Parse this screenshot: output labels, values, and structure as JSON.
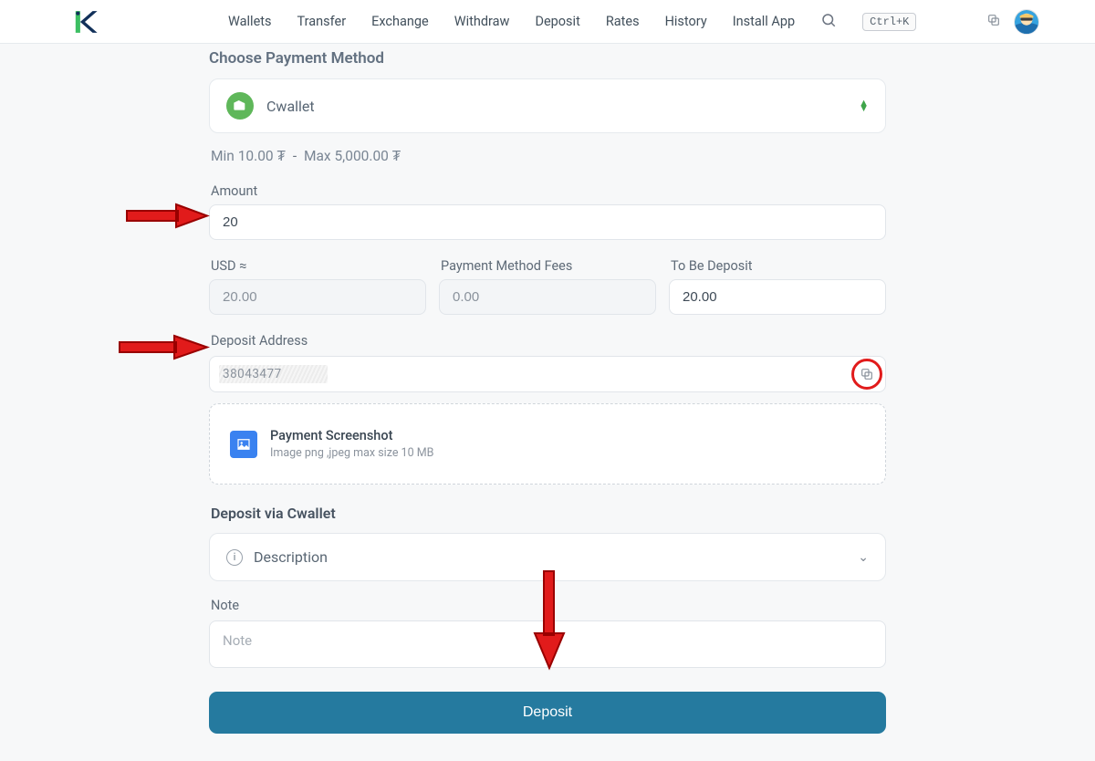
{
  "nav": {
    "items": [
      "Wallets",
      "Transfer",
      "Exchange",
      "Withdraw",
      "Deposit",
      "Rates",
      "History",
      "Install App"
    ],
    "shortcut": "Ctrl+K"
  },
  "section_title": "Choose Payment Method",
  "payment_method": {
    "name": "Cwallet"
  },
  "limits": {
    "min": "Min 10.00 ₮",
    "max": "Max 5,000.00 ₮",
    "separator": "-"
  },
  "amount": {
    "label": "Amount",
    "value": "20"
  },
  "usd": {
    "label": "USD ≈",
    "value": "20.00"
  },
  "fees": {
    "label": "Payment Method Fees",
    "value": "0.00"
  },
  "to_be_deposit": {
    "label": "To Be Deposit",
    "value": "20.00"
  },
  "deposit_address": {
    "label": "Deposit Address",
    "value": "38043477"
  },
  "upload": {
    "title": "Payment Screenshot",
    "subtitle": "Image png ,jpeg max size 10 MB"
  },
  "deposit_via": "Deposit via Cwallet",
  "description_label": "Description",
  "note": {
    "label": "Note",
    "placeholder": "Note"
  },
  "submit_label": "Deposit"
}
